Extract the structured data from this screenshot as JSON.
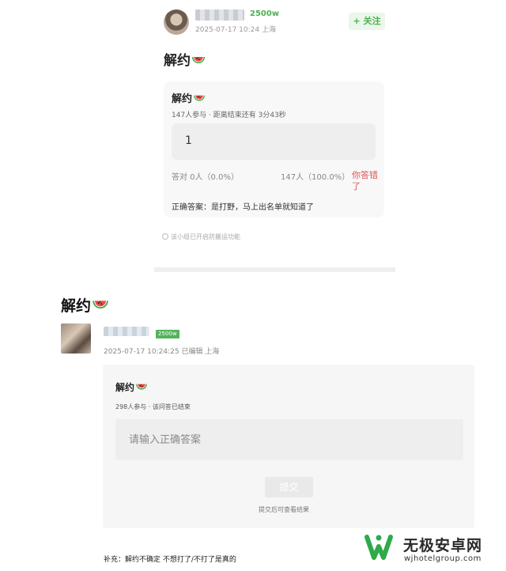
{
  "post1": {
    "follower_count": "2500w",
    "meta": "2025-07-17 10:24  上海",
    "follow_button": "+ 关注",
    "title": "解约",
    "quiz": {
      "title": "解约",
      "meta": "147人参与 · 距离结束还有 3分43秒",
      "answer": "1",
      "correct_stat": "答对  0人（0.0%）",
      "wrong_stat": "147人（100.0%）",
      "wrong_tag": "你答错了",
      "correct_answer": "正确答案：是打野，马上出名单就知道了"
    },
    "notice": "该小组已开启防搬运功能"
  },
  "post2": {
    "title": "解约",
    "follower_badge": "2500w",
    "meta": "2025-07-17 10:24:25 已编辑 上海",
    "quiz": {
      "title": "解约",
      "meta": "298人参与 · 该问答已结束",
      "placeholder": "请输入正确答案",
      "submit_label": "提交",
      "submit_hint": "提交后可查看结果"
    },
    "supplement": "补充：解约不确定 不想打了/不打了是真的"
  },
  "watermark": {
    "name": "无极安卓网",
    "url": "wjhotelgroup.com"
  },
  "colors": {
    "accent_green": "#4cb050",
    "wrong_red": "#e05555"
  },
  "icons": [
    "watermelon-icon",
    "info-icon",
    "site-logo-icon"
  ]
}
